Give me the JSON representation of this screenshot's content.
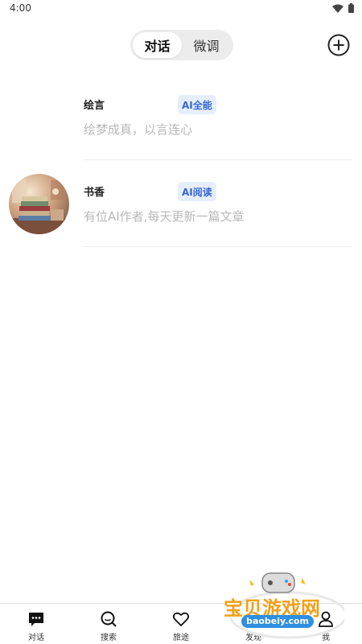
{
  "status_bar": {
    "time": "4:00"
  },
  "header": {
    "tabs": [
      {
        "label": "对话",
        "active": true
      },
      {
        "label": "微调",
        "active": false
      }
    ],
    "add_icon": "plus-circle-icon"
  },
  "chats": [
    {
      "name": "绘言",
      "tag": "AI全能",
      "description": "绘梦成真，以言连心",
      "has_avatar": false
    },
    {
      "name": "书香",
      "tag": "AI阅读",
      "description": "有位AI作者,每天更新一篇文章",
      "has_avatar": true
    }
  ],
  "bottom_nav": [
    {
      "label": "对话",
      "icon": "chat-icon"
    },
    {
      "label": "搜索",
      "icon": "search-icon"
    },
    {
      "label": "旅途",
      "icon": "heart-icon"
    },
    {
      "label": "发现",
      "icon": "explore-icon"
    },
    {
      "label": "我",
      "icon": "person-icon"
    }
  ],
  "watermark": {
    "text": "宝贝游戏网",
    "url": "baobeiy.com"
  },
  "colors": {
    "tag_bg": "#e7eefb",
    "tag_text": "#3767d6",
    "desc_text": "#b9b9b9",
    "watermark": "#f2a11a"
  }
}
